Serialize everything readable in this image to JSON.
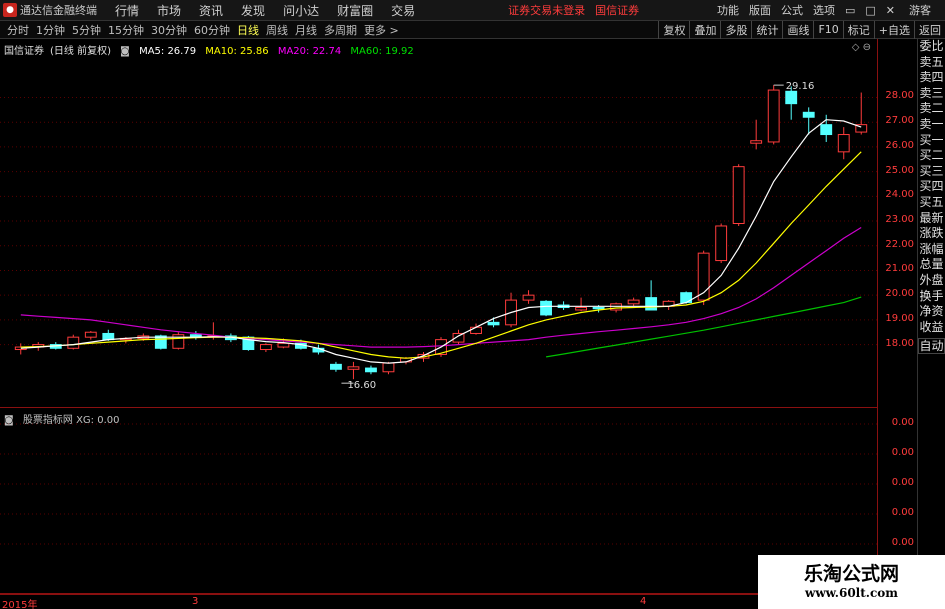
{
  "app": {
    "title": "通达信金融终端",
    "top_menu": [
      "行情",
      "市场",
      "资讯",
      "发现",
      "问小达",
      "财富圈",
      "交易"
    ],
    "login_notice": "证券交易未登录",
    "broker": "国信证券",
    "right_menu": [
      "功能",
      "版面",
      "公式",
      "选项"
    ],
    "right_tag": "游客"
  },
  "toolbar": {
    "periods": [
      "分时",
      "1分钟",
      "5分钟",
      "15分钟",
      "30分钟",
      "60分钟",
      "日线",
      "周线",
      "月线",
      "多周期",
      "更多 >"
    ],
    "active": "日线",
    "right_buttons": [
      "复权",
      "叠加",
      "多股",
      "统计",
      "画线",
      "F10",
      "标记",
      "+自选",
      "返回"
    ]
  },
  "main": {
    "stock": "国信证券",
    "mode": "(日线 前复权)",
    "ma": [
      {
        "label": "MA5: 26.79",
        "color": "#ffffff"
      },
      {
        "label": "MA10: 25.86",
        "color": "#ffff00"
      },
      {
        "label": "MA20: 22.74",
        "color": "#ff00ff"
      },
      {
        "label": "MA60: 19.92",
        "color": "#00e000"
      }
    ],
    "high_label": "29.16",
    "low_label": "16.60",
    "corner_icons": "◇ ⊖"
  },
  "indicator": {
    "title": "股票指标网 XG: 0.00",
    "ticks": [
      "0.00",
      "0.00",
      "0.00",
      "0.00",
      "0.00"
    ]
  },
  "side_items": [
    "委比",
    "卖五",
    "卖四",
    "卖三",
    "卖二",
    "卖一",
    "买一",
    "买二",
    "买三",
    "买四",
    "买五",
    "最新",
    "涨跌",
    "涨幅",
    "总量",
    "外盘",
    "换手",
    "净资",
    "收益"
  ],
  "side_auto": "自动",
  "x_labels": [
    "2015年",
    "3",
    "4"
  ],
  "watermark": {
    "title": "乐淘公式网",
    "url": "www.60lt.com"
  },
  "chart_data": {
    "type": "candlestick",
    "ylim": [
      16.0,
      29.8
    ],
    "yticks": [
      18.0,
      19.0,
      20.0,
      21.0,
      22.0,
      23.0,
      24.0,
      25.0,
      26.0,
      27.0,
      28.0
    ],
    "candles": [
      [
        17.8,
        18.05,
        17.6,
        17.9
      ],
      [
        17.9,
        18.1,
        17.75,
        18.0
      ],
      [
        18.0,
        18.1,
        17.8,
        17.85
      ],
      [
        17.85,
        18.4,
        17.8,
        18.3
      ],
      [
        18.3,
        18.55,
        18.2,
        18.5
      ],
      [
        18.45,
        18.6,
        18.15,
        18.2
      ],
      [
        18.2,
        18.3,
        18.05,
        18.25
      ],
      [
        18.25,
        18.45,
        18.15,
        18.35
      ],
      [
        18.35,
        18.4,
        17.8,
        17.85
      ],
      [
        17.85,
        18.5,
        17.8,
        18.4
      ],
      [
        18.4,
        18.55,
        18.2,
        18.3
      ],
      [
        18.3,
        18.9,
        18.2,
        18.35
      ],
      [
        18.35,
        18.45,
        18.1,
        18.2
      ],
      [
        18.3,
        18.35,
        17.75,
        17.8
      ],
      [
        17.8,
        18.05,
        17.7,
        18.0
      ],
      [
        17.9,
        18.25,
        17.85,
        18.05
      ],
      [
        18.05,
        18.2,
        17.8,
        17.85
      ],
      [
        17.85,
        18.0,
        17.6,
        17.7
      ],
      [
        17.2,
        17.3,
        16.9,
        17.0
      ],
      [
        17.0,
        17.3,
        16.6,
        17.1
      ],
      [
        17.05,
        17.15,
        16.8,
        16.9
      ],
      [
        16.9,
        17.3,
        16.8,
        17.25
      ],
      [
        17.3,
        17.5,
        17.2,
        17.45
      ],
      [
        17.45,
        17.7,
        17.3,
        17.6
      ],
      [
        17.6,
        18.3,
        17.5,
        18.2
      ],
      [
        18.1,
        18.6,
        18.0,
        18.45
      ],
      [
        18.45,
        18.85,
        18.4,
        18.7
      ],
      [
        18.9,
        19.1,
        18.7,
        18.8
      ],
      [
        18.8,
        20.1,
        18.7,
        19.8
      ],
      [
        19.8,
        20.2,
        19.65,
        20.0
      ],
      [
        19.75,
        19.8,
        19.15,
        19.2
      ],
      [
        19.6,
        19.75,
        19.4,
        19.5
      ],
      [
        19.4,
        19.9,
        19.35,
        19.5
      ],
      [
        19.5,
        19.6,
        19.3,
        19.45
      ],
      [
        19.4,
        19.7,
        19.3,
        19.65
      ],
      [
        19.65,
        19.9,
        19.55,
        19.8
      ],
      [
        19.9,
        20.6,
        19.5,
        19.4
      ],
      [
        19.55,
        19.8,
        19.4,
        19.75
      ],
      [
        20.1,
        20.15,
        19.65,
        19.7
      ],
      [
        19.8,
        21.8,
        19.6,
        21.7
      ],
      [
        21.4,
        22.9,
        21.3,
        22.8
      ],
      [
        22.9,
        25.3,
        22.8,
        25.2
      ],
      [
        26.15,
        27.1,
        25.9,
        26.25
      ],
      [
        26.2,
        28.5,
        26.1,
        28.3
      ],
      [
        28.25,
        28.45,
        27.1,
        27.75
      ],
      [
        27.4,
        27.6,
        26.5,
        27.2
      ],
      [
        26.9,
        27.3,
        26.2,
        26.5
      ],
      [
        25.8,
        26.8,
        25.5,
        26.5
      ],
      [
        26.6,
        28.2,
        26.5,
        26.9
      ]
    ],
    "ma5": [
      17.85,
      17.9,
      17.95,
      18.0,
      18.1,
      18.2,
      18.25,
      18.3,
      18.3,
      18.3,
      18.3,
      18.32,
      18.3,
      18.2,
      18.12,
      18.08,
      18.0,
      17.85,
      17.6,
      17.45,
      17.3,
      17.25,
      17.3,
      17.55,
      17.9,
      18.35,
      18.7,
      19.05,
      19.3,
      19.5,
      19.55,
      19.55,
      19.55,
      19.55,
      19.55,
      19.55,
      19.55,
      19.55,
      19.7,
      20.1,
      20.8,
      21.9,
      23.2,
      24.6,
      25.6,
      26.55,
      27.1,
      27.05,
      26.8
    ],
    "ma10": [
      17.9,
      17.92,
      17.95,
      18.0,
      18.05,
      18.1,
      18.15,
      18.2,
      18.22,
      18.25,
      18.28,
      18.3,
      18.3,
      18.28,
      18.25,
      18.2,
      18.15,
      18.05,
      17.9,
      17.75,
      17.6,
      17.5,
      17.45,
      17.5,
      17.65,
      17.85,
      18.05,
      18.3,
      18.55,
      18.8,
      19.0,
      19.15,
      19.3,
      19.4,
      19.48,
      19.5,
      19.52,
      19.55,
      19.6,
      19.75,
      20.1,
      20.6,
      21.3,
      22.1,
      22.9,
      23.65,
      24.4,
      25.1,
      25.8
    ],
    "ma20": [
      19.2,
      19.15,
      19.1,
      19.05,
      19.0,
      18.9,
      18.8,
      18.7,
      18.6,
      18.52,
      18.45,
      18.38,
      18.3,
      18.25,
      18.2,
      18.15,
      18.1,
      18.05,
      18.0,
      17.95,
      17.9,
      17.9,
      17.9,
      17.92,
      17.95,
      18.0,
      18.05,
      18.1,
      18.15,
      18.2,
      18.3,
      18.38,
      18.45,
      18.52,
      18.58,
      18.65,
      18.72,
      18.8,
      18.9,
      19.05,
      19.25,
      19.5,
      19.85,
      20.3,
      20.8,
      21.3,
      21.8,
      22.3,
      22.74
    ],
    "ma60_start": 30,
    "ma60": [
      17.5,
      17.62,
      17.74,
      17.86,
      17.98,
      18.1,
      18.22,
      18.34,
      18.46,
      18.58,
      18.72,
      18.86,
      19.0,
      19.14,
      19.28,
      19.42,
      19.56,
      19.7,
      19.92
    ],
    "up_color": "#ff3c3c",
    "down_color": "#54ffff",
    "ma5_color": "#ffffff",
    "ma10_color": "#ffff00",
    "ma20_color": "#cc00cc",
    "ma60_color": "#00c000",
    "high_index": 43,
    "low_index": 19
  }
}
